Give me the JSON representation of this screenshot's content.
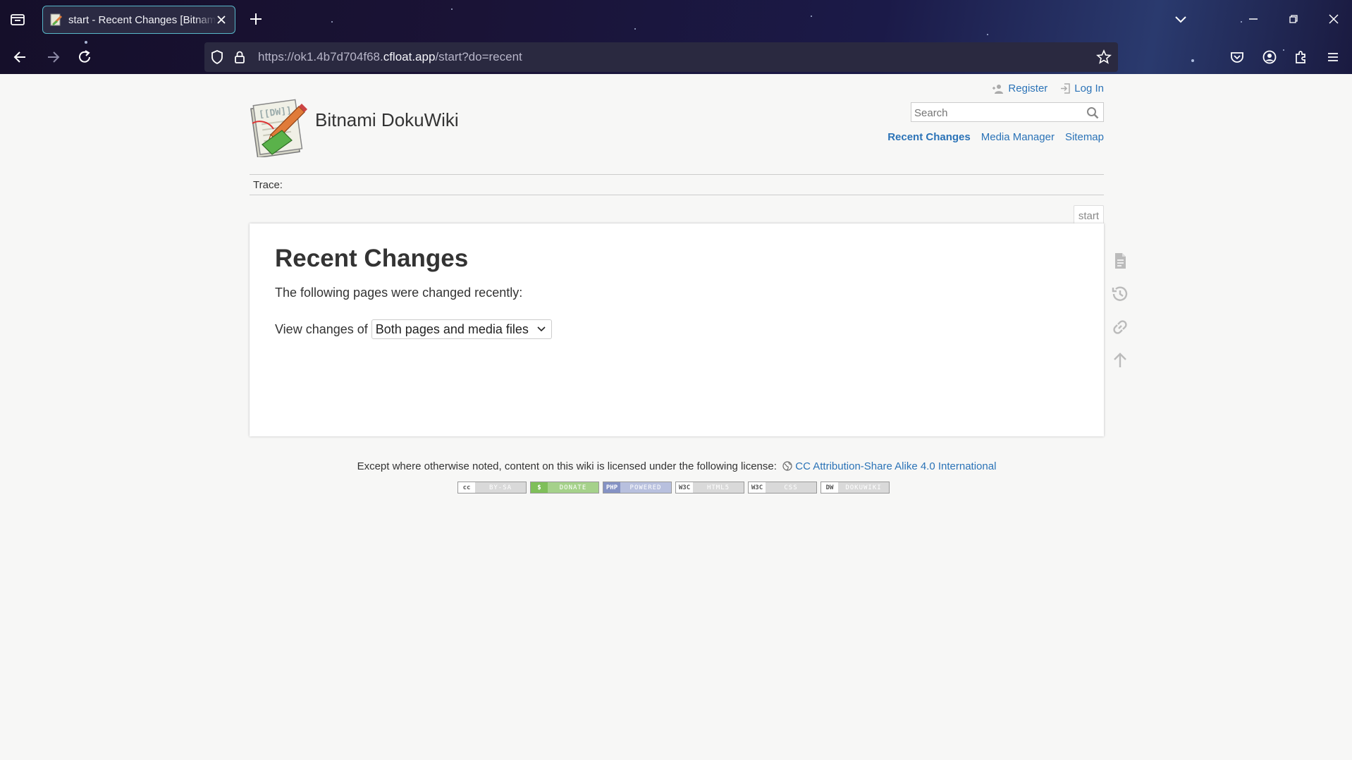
{
  "browser": {
    "tab_title": "start - Recent Changes [Bitnami DokuWiki]",
    "url_prefix": "https://ok1.4b7d704f68.",
    "url_host": "cfloat.app",
    "url_path": "/start?do=recent"
  },
  "header": {
    "site_title": "Bitnami DokuWiki",
    "register_label": "Register",
    "login_label": "Log In",
    "search_placeholder": "Search",
    "sitetools": {
      "recent_changes": "Recent Changes",
      "media_manager": "Media Manager",
      "sitemap": "Sitemap"
    },
    "breadcrumbs_label": "Trace:",
    "page_id": "start"
  },
  "main": {
    "heading": "Recent Changes",
    "intro": "The following pages were changed recently:",
    "view_changes_label": "View changes of",
    "view_changes_selected": "Both pages and media files"
  },
  "footer": {
    "license_text": "Except where otherwise noted, content on this wiki is licensed under the following license:",
    "license_link": "CC Attribution-Share Alike 4.0 International",
    "badges": [
      {
        "icon": "cc",
        "label": "BY-SA"
      },
      {
        "icon": "$",
        "label": "DONATE"
      },
      {
        "icon": "PHP",
        "label": "POWERED"
      },
      {
        "icon": "W3C",
        "label": "HTML5"
      },
      {
        "icon": "W3C",
        "label": "CSS"
      },
      {
        "icon": "DW",
        "label": "DOKUWIKI"
      }
    ]
  },
  "colors": {
    "link": "#2b73b7",
    "tab_border": "#57b7c9",
    "page_bg": "#f7f7f6"
  }
}
